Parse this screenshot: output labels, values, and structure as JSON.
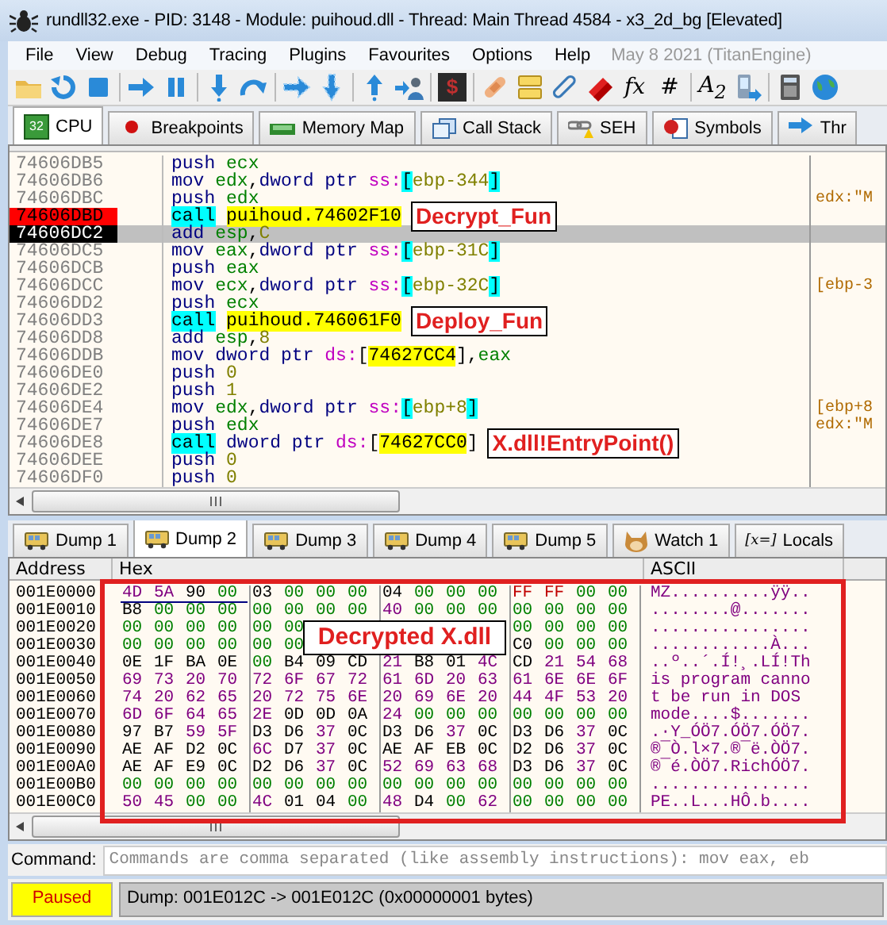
{
  "window": {
    "title": "rundll32.exe - PID: 3148 - Module: puihoud.dll - Thread: Main Thread 4584 - x3_2d_bg [Elevated]"
  },
  "menu": [
    "File",
    "View",
    "Debug",
    "Tracing",
    "Plugins",
    "Favourites",
    "Options",
    "Help"
  ],
  "build_info": "May 8 2021 (TitanEngine)",
  "toolbar": [
    {
      "kind": "open"
    },
    {
      "kind": "restart"
    },
    {
      "kind": "stop"
    },
    {
      "kind": "separator"
    },
    {
      "kind": "run"
    },
    {
      "kind": "pause"
    },
    {
      "kind": "separator"
    },
    {
      "kind": "step-into"
    },
    {
      "kind": "step-over"
    },
    {
      "kind": "separator"
    },
    {
      "kind": "trace-into"
    },
    {
      "kind": "trace-over"
    },
    {
      "kind": "separator"
    },
    {
      "kind": "step-out"
    },
    {
      "kind": "run-user"
    },
    {
      "kind": "separator"
    },
    {
      "kind": "dark-glyph",
      "text": "$"
    },
    {
      "kind": "separator"
    },
    {
      "kind": "patch"
    },
    {
      "kind": "comment"
    },
    {
      "kind": "label"
    },
    {
      "kind": "bookmark"
    },
    {
      "kind": "glyph",
      "text": "fx"
    },
    {
      "kind": "glyph",
      "text": "#"
    },
    {
      "kind": "separator"
    },
    {
      "kind": "glyph",
      "text": "A$_{2}$"
    },
    {
      "kind": "device"
    },
    {
      "kind": "separator"
    },
    {
      "kind": "calculator"
    },
    {
      "kind": "globe"
    }
  ],
  "tabs": [
    {
      "label": "CPU",
      "kind": "cpu",
      "icon_text": "32",
      "selected": true
    },
    {
      "label": "Breakpoints",
      "kind": "breakpoint",
      "selected": false
    },
    {
      "label": "Memory Map",
      "kind": "memory",
      "selected": false
    },
    {
      "label": "Call Stack",
      "kind": "callstack",
      "selected": false
    },
    {
      "label": "SEH",
      "kind": "seh",
      "selected": false
    },
    {
      "label": "Symbols",
      "kind": "symbols",
      "selected": false
    },
    {
      "label": "Thr",
      "kind": "threads",
      "selected": false
    }
  ],
  "disassembly": [
    {
      "address": "74606DB5",
      "breakpoint": false,
      "selected": false,
      "mnemonic": "push",
      "kind": "plain",
      "operands": [
        {
          "kind": "reg",
          "text": "ecx"
        }
      ]
    },
    {
      "address": "74606DB6",
      "breakpoint": false,
      "selected": false,
      "mnemonic": "mov",
      "kind": "plain",
      "operands": [
        {
          "kind": "reg",
          "text": "edx"
        },
        {
          "kind": "punct",
          "text": ","
        },
        {
          "kind": "keyword",
          "text": "dword ptr "
        },
        {
          "kind": "segment",
          "text": "ss:"
        },
        {
          "kind": "bracket",
          "text": "["
        },
        {
          "kind": "number",
          "text": "ebp-344"
        },
        {
          "kind": "bracket",
          "text": "]"
        }
      ]
    },
    {
      "address": "74606DBC",
      "breakpoint": false,
      "selected": false,
      "mnemonic": "push",
      "kind": "plain",
      "operands": [
        {
          "kind": "reg",
          "text": "edx"
        }
      ],
      "comment": "edx:\"M"
    },
    {
      "address": "74606DBD",
      "breakpoint": true,
      "selected": false,
      "mnemonic": "call",
      "kind": "call",
      "operands": [
        {
          "kind": "target",
          "text": "puihoud.74602F10"
        }
      ],
      "annotation": "Decrypt_Fun"
    },
    {
      "address": "74606DC2",
      "breakpoint": false,
      "selected": true,
      "mnemonic": "add",
      "kind": "plain",
      "operands": [
        {
          "kind": "reg",
          "text": "esp"
        },
        {
          "kind": "punct",
          "text": ","
        },
        {
          "kind": "number",
          "text": "C"
        }
      ]
    },
    {
      "address": "74606DC5",
      "breakpoint": false,
      "selected": false,
      "mnemonic": "mov",
      "kind": "plain",
      "operands": [
        {
          "kind": "reg",
          "text": "eax"
        },
        {
          "kind": "punct",
          "text": ","
        },
        {
          "kind": "keyword",
          "text": "dword ptr "
        },
        {
          "kind": "segment",
          "text": "ss:"
        },
        {
          "kind": "bracket",
          "text": "["
        },
        {
          "kind": "number",
          "text": "ebp-31C"
        },
        {
          "kind": "bracket",
          "text": "]"
        }
      ]
    },
    {
      "address": "74606DCB",
      "breakpoint": false,
      "selected": false,
      "mnemonic": "push",
      "kind": "plain",
      "operands": [
        {
          "kind": "reg",
          "text": "eax"
        }
      ]
    },
    {
      "address": "74606DCC",
      "breakpoint": false,
      "selected": false,
      "mnemonic": "mov",
      "kind": "plain",
      "operands": [
        {
          "kind": "reg",
          "text": "ecx"
        },
        {
          "kind": "punct",
          "text": ","
        },
        {
          "kind": "keyword",
          "text": "dword ptr "
        },
        {
          "kind": "segment",
          "text": "ss:"
        },
        {
          "kind": "bracket",
          "text": "["
        },
        {
          "kind": "number",
          "text": "ebp-32C"
        },
        {
          "kind": "bracket",
          "text": "]"
        }
      ],
      "comment": "[ebp-3"
    },
    {
      "address": "74606DD2",
      "breakpoint": false,
      "selected": false,
      "mnemonic": "push",
      "kind": "plain",
      "operands": [
        {
          "kind": "reg",
          "text": "ecx"
        }
      ]
    },
    {
      "address": "74606DD3",
      "breakpoint": false,
      "selected": false,
      "mnemonic": "call",
      "kind": "call",
      "operands": [
        {
          "kind": "target",
          "text": "puihoud.746061F0"
        }
      ],
      "annotation": "Deploy_Fun"
    },
    {
      "address": "74606DD8",
      "breakpoint": false,
      "selected": false,
      "mnemonic": "add",
      "kind": "plain",
      "operands": [
        {
          "kind": "reg",
          "text": "esp"
        },
        {
          "kind": "punct",
          "text": ","
        },
        {
          "kind": "number",
          "text": "8"
        }
      ]
    },
    {
      "address": "74606DDB",
      "breakpoint": false,
      "selected": false,
      "mnemonic": "mov",
      "kind": "plain",
      "operands": [
        {
          "kind": "keyword",
          "text": "dword ptr "
        },
        {
          "kind": "segment",
          "text": "ds:"
        },
        {
          "kind": "punct",
          "text": "["
        },
        {
          "kind": "target",
          "text": "74627CC4"
        },
        {
          "kind": "punct",
          "text": "]"
        },
        {
          "kind": "punct",
          "text": ","
        },
        {
          "kind": "reg",
          "text": "eax"
        }
      ]
    },
    {
      "address": "74606DE0",
      "breakpoint": false,
      "selected": false,
      "mnemonic": "push",
      "kind": "plain",
      "operands": [
        {
          "kind": "number",
          "text": "0"
        }
      ]
    },
    {
      "address": "74606DE2",
      "breakpoint": false,
      "selected": false,
      "mnemonic": "push",
      "kind": "plain",
      "operands": [
        {
          "kind": "number",
          "text": "1"
        }
      ]
    },
    {
      "address": "74606DE4",
      "breakpoint": false,
      "selected": false,
      "mnemonic": "mov",
      "kind": "plain",
      "operands": [
        {
          "kind": "reg",
          "text": "edx"
        },
        {
          "kind": "punct",
          "text": ","
        },
        {
          "kind": "keyword",
          "text": "dword ptr "
        },
        {
          "kind": "segment",
          "text": "ss:"
        },
        {
          "kind": "bracket",
          "text": "["
        },
        {
          "kind": "number",
          "text": "ebp+8"
        },
        {
          "kind": "bracket",
          "text": "]"
        }
      ],
      "comment": "[ebp+8"
    },
    {
      "address": "74606DE7",
      "breakpoint": false,
      "selected": false,
      "mnemonic": "push",
      "kind": "plain",
      "operands": [
        {
          "kind": "reg",
          "text": "edx"
        }
      ],
      "comment": "edx:\"M"
    },
    {
      "address": "74606DE8",
      "breakpoint": false,
      "selected": false,
      "mnemonic": "call",
      "kind": "call",
      "operands": [
        {
          "kind": "keyword",
          "text": "dword ptr "
        },
        {
          "kind": "segment",
          "text": "ds:"
        },
        {
          "kind": "punct",
          "text": "["
        },
        {
          "kind": "target",
          "text": "74627CC0"
        },
        {
          "kind": "punct",
          "text": "]"
        }
      ],
      "annotation": "X.dll!EntryPoint()"
    },
    {
      "address": "74606DEE",
      "breakpoint": false,
      "selected": false,
      "mnemonic": "push",
      "kind": "plain",
      "operands": [
        {
          "kind": "number",
          "text": "0"
        }
      ]
    },
    {
      "address": "74606DF0",
      "breakpoint": false,
      "selected": false,
      "mnemonic": "push",
      "kind": "plain",
      "operands": [
        {
          "kind": "number",
          "text": "0"
        }
      ]
    }
  ],
  "dump_tabs": [
    {
      "label": "Dump 1",
      "kind": "dump",
      "selected": false
    },
    {
      "label": "Dump 2",
      "kind": "dump",
      "selected": true
    },
    {
      "label": "Dump 3",
      "kind": "dump",
      "selected": false
    },
    {
      "label": "Dump 4",
      "kind": "dump",
      "selected": false
    },
    {
      "label": "Dump 5",
      "kind": "dump",
      "selected": false
    },
    {
      "label": "Watch 1",
      "kind": "watch",
      "selected": false
    },
    {
      "label": "Locals",
      "kind": "locals",
      "icon_text": "[x=]",
      "selected": false
    }
  ],
  "dump": {
    "columns": [
      "Address",
      "Hex",
      "ASCII"
    ],
    "annotation": "Decrypted X.dll",
    "rows": [
      {
        "address": "001E0000",
        "bytes": [
          "4D",
          "5A",
          "90",
          "00",
          "03",
          "00",
          "00",
          "00",
          "04",
          "00",
          "00",
          "00",
          "FF",
          "FF",
          "00",
          "00"
        ],
        "ascii": "MZ..........ÿÿ.."
      },
      {
        "address": "001E0010",
        "bytes": [
          "B8",
          "00",
          "00",
          "00",
          "00",
          "00",
          "00",
          "00",
          "40",
          "00",
          "00",
          "00",
          "00",
          "00",
          "00",
          "00"
        ],
        "ascii": "........@......."
      },
      {
        "address": "001E0020",
        "bytes_before_label": [
          "00",
          "00",
          "00",
          "00",
          "00",
          "00"
        ],
        "bytes_after_label": [
          "00",
          "00",
          "00",
          "00"
        ],
        "ascii": "................"
      },
      {
        "address": "001E0030",
        "bytes_before_label": [
          "00",
          "00",
          "00",
          "00",
          "00",
          "00"
        ],
        "bytes_after_label": [
          "C0",
          "00",
          "00",
          "00"
        ],
        "ascii": "............À..."
      },
      {
        "address": "001E0040",
        "bytes": [
          "0E",
          "1F",
          "BA",
          "0E",
          "00",
          "B4",
          "09",
          "CD",
          "21",
          "B8",
          "01",
          "4C",
          "CD",
          "21",
          "54",
          "68"
        ],
        "ascii": "..º..´.Í!¸.LÍ!Th"
      },
      {
        "address": "001E0050",
        "bytes": [
          "69",
          "73",
          "20",
          "70",
          "72",
          "6F",
          "67",
          "72",
          "61",
          "6D",
          "20",
          "63",
          "61",
          "6E",
          "6E",
          "6F"
        ],
        "ascii": "is program canno"
      },
      {
        "address": "001E0060",
        "bytes": [
          "74",
          "20",
          "62",
          "65",
          "20",
          "72",
          "75",
          "6E",
          "20",
          "69",
          "6E",
          "20",
          "44",
          "4F",
          "53",
          "20"
        ],
        "ascii": "t be run in DOS "
      },
      {
        "address": "001E0070",
        "bytes": [
          "6D",
          "6F",
          "64",
          "65",
          "2E",
          "0D",
          "0D",
          "0A",
          "24",
          "00",
          "00",
          "00",
          "00",
          "00",
          "00",
          "00"
        ],
        "ascii": "mode....$......."
      },
      {
        "address": "001E0080",
        "bytes": [
          "97",
          "B7",
          "59",
          "5F",
          "D3",
          "D6",
          "37",
          "0C",
          "D3",
          "D6",
          "37",
          "0C",
          "D3",
          "D6",
          "37",
          "0C"
        ],
        "ascii": ".·Y_ÓÖ7.ÓÖ7.ÓÖ7."
      },
      {
        "address": "001E0090",
        "bytes": [
          "AE",
          "AF",
          "D2",
          "0C",
          "6C",
          "D7",
          "37",
          "0C",
          "AE",
          "AF",
          "EB",
          "0C",
          "D2",
          "D6",
          "37",
          "0C"
        ],
        "ascii": "®¯Ò.l×7.®¯ë.ÒÖ7."
      },
      {
        "address": "001E00A0",
        "bytes": [
          "AE",
          "AF",
          "E9",
          "0C",
          "D2",
          "D6",
          "37",
          "0C",
          "52",
          "69",
          "63",
          "68",
          "D3",
          "D6",
          "37",
          "0C"
        ],
        "ascii": "®¯é.ÒÖ7.RichÓÖ7."
      },
      {
        "address": "001E00B0",
        "bytes": [
          "00",
          "00",
          "00",
          "00",
          "00",
          "00",
          "00",
          "00",
          "00",
          "00",
          "00",
          "00",
          "00",
          "00",
          "00",
          "00"
        ],
        "ascii": "................"
      },
      {
        "address": "001E00C0",
        "bytes": [
          "50",
          "45",
          "00",
          "00",
          "4C",
          "01",
          "04",
          "00",
          "48",
          "D4",
          "00",
          "62",
          "00",
          "00",
          "00",
          "00"
        ],
        "ascii": "PE..L...HÔ.b...."
      }
    ]
  },
  "command": {
    "label": "Command:",
    "placeholder": "Commands are comma separated (like assembly instructions): mov eax, eb"
  },
  "status_bar": {
    "state": "Paused",
    "message": "Dump: 001E012C -> 001E012C (0x00000001 bytes)"
  }
}
